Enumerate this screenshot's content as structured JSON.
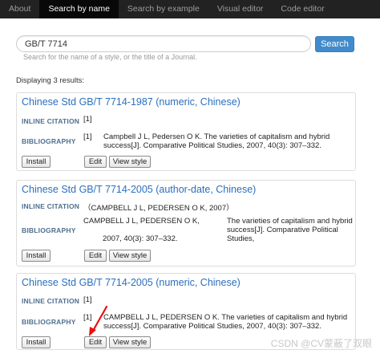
{
  "nav": {
    "tabs": [
      {
        "label": "About",
        "active": false
      },
      {
        "label": "Search by name",
        "active": true
      },
      {
        "label": "Search by example",
        "active": false
      },
      {
        "label": "Visual editor",
        "active": false
      },
      {
        "label": "Code editor",
        "active": false
      }
    ]
  },
  "search": {
    "value": "GB/T 7714",
    "button_label": "Search",
    "help_text": "Search for the name of a style, or the title of a Journal."
  },
  "results": {
    "count_text": "Displaying 3 results:",
    "items": [
      {
        "title": "Chinese Std GB/T 7714-1987 (numeric, Chinese)",
        "inline_label": "INLINE CITATION",
        "inline_text": "[1]",
        "bib_label": "BIBLIOGRAPHY",
        "bib_number": "[1]",
        "bib_lines": [
          "Campbell J L, Pedersen O K. The varieties of capitalism and hybrid",
          "success[J]. Comparative Political Studies, 2007, 40(3): 307–332."
        ],
        "install_label": "Install",
        "edit_label": "Edit",
        "view_label": "View style"
      },
      {
        "title": "Chinese Std GB/T 7714-2005 (author-date, Chinese)",
        "inline_label": "INLINE CITATION",
        "inline_text": "（CAMPBELL J L, PEDERSEN O K,  2007）",
        "bib_label": "BIBLIOGRAPHY",
        "bib_lines": [
          "CAMPBELL J L, PEDERSEN O K,",
          "2007, 40(3): 307–332."
        ],
        "bib_right_lines": [
          "The varieties of capitalism and hybrid",
          "success[J]. Comparative Political Studies,"
        ],
        "install_label": "Install",
        "edit_label": "Edit",
        "view_label": "View style"
      },
      {
        "title": "Chinese Std GB/T 7714-2005 (numeric, Chinese)",
        "inline_label": "INLINE CITATION",
        "inline_text": "[1]",
        "bib_label": "BIBLIOGRAPHY",
        "bib_number": "[1]",
        "bib_lines": [
          "CAMPBELL J L, PEDERSEN O K. The varieties of capitalism and hybrid",
          "success[J]. Comparative Political Studies, 2007, 40(3): 307–332."
        ],
        "install_label": "Install",
        "edit_label": "Edit",
        "view_label": "View style"
      }
    ]
  },
  "annotation": {
    "arrow_color": "#e81010"
  },
  "watermark": "CSDN @CV蒙蔽了双眼"
}
